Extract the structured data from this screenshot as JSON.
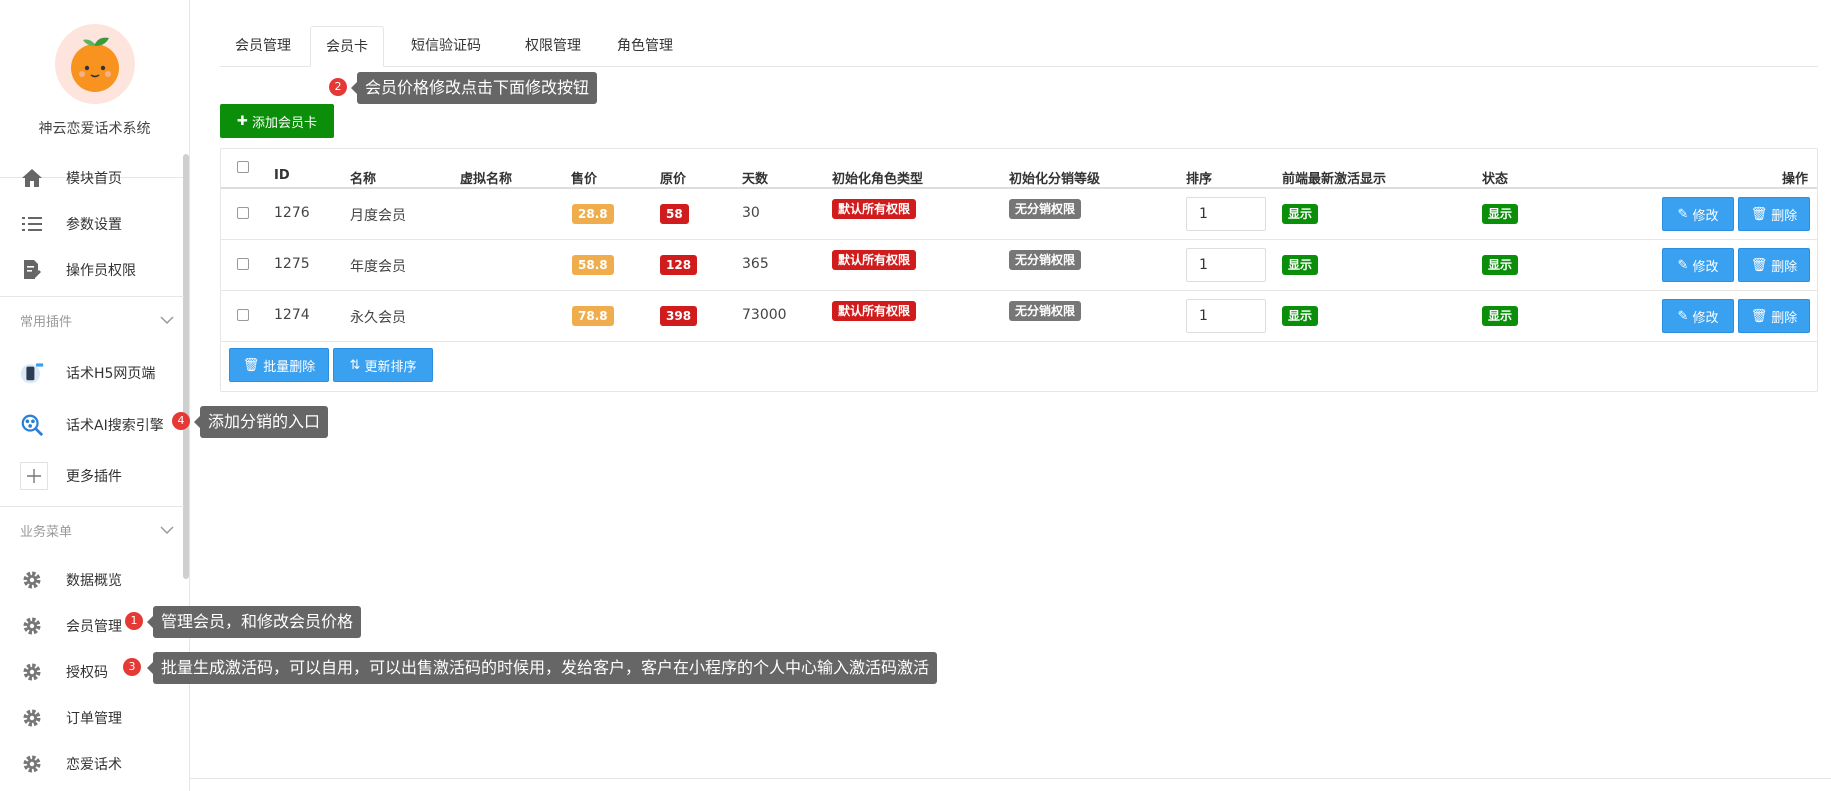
{
  "sidebar": {
    "app_name": "神云恋爱话术系统",
    "items_top": [
      {
        "label": "模块首页",
        "icon": "home-icon"
      },
      {
        "label": "参数设置",
        "icon": "list-icon"
      },
      {
        "label": "操作员权限",
        "icon": "edit-doc-icon"
      }
    ],
    "group_plugins": "常用插件",
    "items_plugins": [
      {
        "label": "话术H5网页端",
        "icon": "phone-icon"
      },
      {
        "label": "话术AI搜索引擎",
        "icon": "ai-search-icon"
      },
      {
        "label": "更多插件",
        "icon": "plus-icon"
      }
    ],
    "group_business": "业务菜单",
    "items_business": [
      {
        "label": "数据概览",
        "icon": "gear-icon"
      },
      {
        "label": "会员管理",
        "icon": "gear-icon"
      },
      {
        "label": "授权码",
        "icon": "gear-icon"
      },
      {
        "label": "订单管理",
        "icon": "gear-icon"
      },
      {
        "label": "恋爱话术",
        "icon": "gear-icon"
      }
    ]
  },
  "tabs": [
    "会员管理",
    "会员卡",
    "短信验证码",
    "权限管理",
    "角色管理"
  ],
  "active_tab": "会员卡",
  "tooltips": [
    {
      "num": "2",
      "text": "会员价格修改点击下面修改按钮"
    },
    {
      "num": "4",
      "text": "添加分销的入口"
    },
    {
      "num": "1",
      "text": "管理会员，和修改会员价格"
    },
    {
      "num": "3",
      "text": "批量生成激活码，可以自用，可以出售激活码的时候用，发给客户，客户在小程序的个人中心输入激活码激活"
    }
  ],
  "toolbar": {
    "add_label": "添加会员卡"
  },
  "table": {
    "columns": [
      "ID",
      "名称",
      "虚拟名称",
      "售价",
      "原价",
      "天数",
      "初始化角色类型",
      "初始化分销等级",
      "排序",
      "前端最新激活显示",
      "状态",
      "操作"
    ],
    "rows": [
      {
        "id": "1276",
        "name": "月度会员",
        "virtual_name": "",
        "price": "28.8",
        "original": "58",
        "days": "30",
        "role_type": "默认所有权限",
        "dist_level": "无分销权限",
        "sort": "1",
        "front_show": "显示",
        "status": "显示"
      },
      {
        "id": "1275",
        "name": "年度会员",
        "virtual_name": "",
        "price": "58.8",
        "original": "128",
        "days": "365",
        "role_type": "默认所有权限",
        "dist_level": "无分销权限",
        "sort": "1",
        "front_show": "显示",
        "status": "显示"
      },
      {
        "id": "1274",
        "name": "永久会员",
        "virtual_name": "",
        "price": "78.8",
        "original": "398",
        "days": "73000",
        "role_type": "默认所有权限",
        "dist_level": "无分销权限",
        "sort": "1",
        "front_show": "显示",
        "status": "显示"
      }
    ],
    "edit_label": "修改",
    "delete_label": "删除"
  },
  "footer_actions": {
    "batch_delete": "批量删除",
    "update_sort": "更新排序"
  },
  "colors": {
    "green": "#0b8f0b",
    "blue": "#3aa0f0",
    "red": "#d01c1c",
    "orange": "#f0ad4e",
    "gray": "#777777",
    "tooltip": "#666666"
  }
}
